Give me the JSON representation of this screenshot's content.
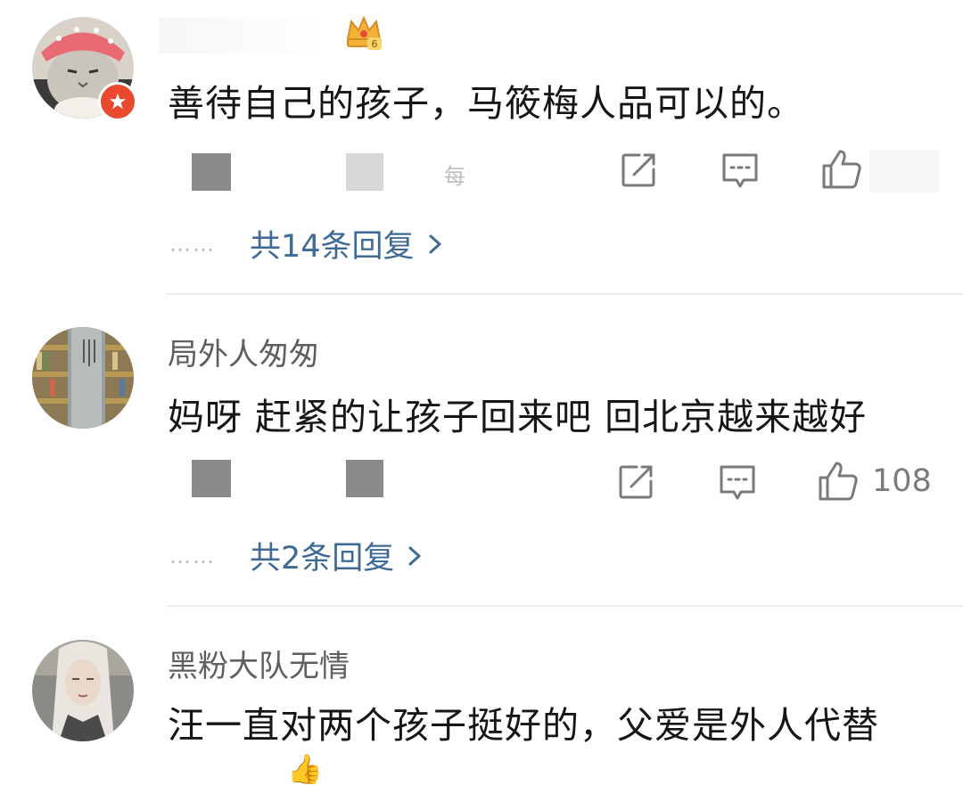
{
  "comments": [
    {
      "username": "",
      "text": "善待自己的孩子，马筱梅人品可以的。",
      "faint_text": "每",
      "like_count": "",
      "replies_label": "共14条回复",
      "colors": {
        "avatar_bg": "#d9d2c8",
        "hat": "#e86a73",
        "badge": "#e8492f"
      }
    },
    {
      "username": "局外人匆匆",
      "text": "妈呀 赶紧的让孩子回来吧 回北京越来越好",
      "like_count": "108",
      "replies_label": "共2条回复",
      "colors": {
        "avatar_bg": "#8c7a55"
      }
    },
    {
      "username": "黑粉大队无情",
      "text": "汪一直对两个孩子挺好的，父爱是外人代替",
      "emoji": "👍",
      "colors": {
        "avatar_bg": "#8b8a86"
      }
    }
  ],
  "dots_label": "……",
  "colors": {
    "link": "#3f6a95",
    "icon": "#7a7a7a",
    "divider": "#ececec"
  }
}
